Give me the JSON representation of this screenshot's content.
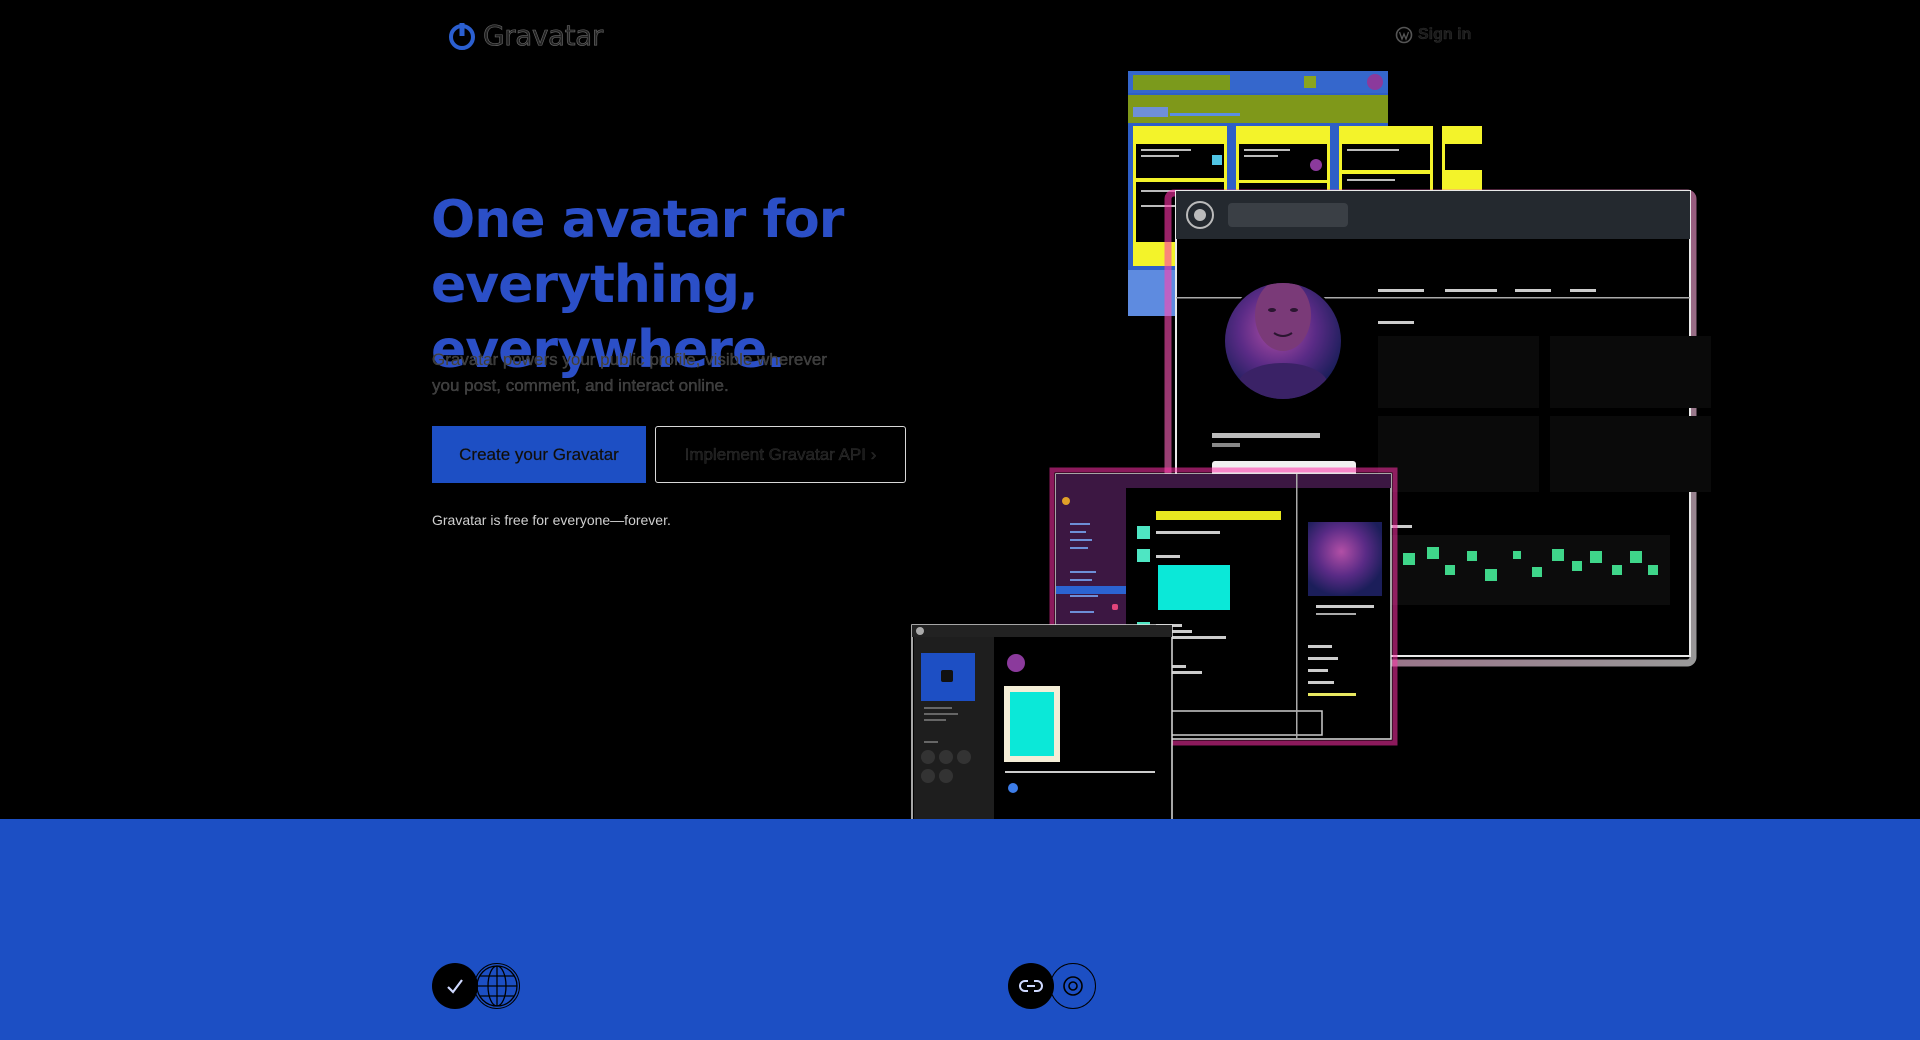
{
  "header": {
    "brand": "Gravatar",
    "signin_label": "Sign in"
  },
  "hero": {
    "title_line1": "One avatar for",
    "title_line2": "everything, everywhere.",
    "subtitle_line1": "Gravatar powers your public profile, visible wherever",
    "subtitle_line2": "you post, comment, and interact online.",
    "primary_cta": "Create your Gravatar",
    "secondary_cta": "Implement Gravatar API",
    "secondary_cta_chevron": "›",
    "free_note": "Gravatar is free for everyone—forever."
  },
  "colors": {
    "brand_blue": "#1d4fc4",
    "title_blue": "#2b4fc7",
    "background": "#000000"
  },
  "icons": {
    "logo": "gravatar-power-icon",
    "signin": "wordpress-icon",
    "feature1": [
      "checkmark-icon",
      "globe-icon"
    ],
    "feature2": [
      "link-icon",
      "settings-icon"
    ]
  }
}
